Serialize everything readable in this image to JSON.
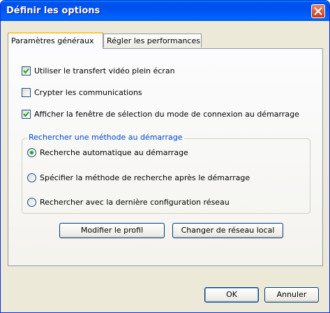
{
  "window": {
    "title": "Définir les options"
  },
  "tabs": [
    {
      "label": "Paramètres généraux",
      "active": true
    },
    {
      "label": "Régler les performances",
      "active": false
    }
  ],
  "options": {
    "fullscreen_video": {
      "label": "Utiliser le transfert vidéo plein écran",
      "checked": true
    },
    "encrypt": {
      "label": "Crypter les communications",
      "checked": false
    },
    "show_connection_mode": {
      "label": "Afficher la fenêtre de sélection du mode de connexion au démarrage",
      "checked": true
    }
  },
  "search_group": {
    "title": "Rechercher une méthode au démarrage",
    "radios": [
      {
        "label": "Recherche automatique au démarrage",
        "selected": true
      },
      {
        "label": "Spécifier la méthode de recherche après le démarrage",
        "selected": false
      },
      {
        "label": "Rechercher avec la dernière configuration réseau",
        "selected": false
      }
    ]
  },
  "buttons": {
    "modify_profile": "Modifier le profil",
    "change_network": "Changer de réseau local",
    "ok": "OK",
    "cancel": "Annuler"
  },
  "colors": {
    "titlebar": "#0054e3",
    "group_title": "#0046d5",
    "radio_dot": "#21a121",
    "check_mark": "#21a121"
  }
}
